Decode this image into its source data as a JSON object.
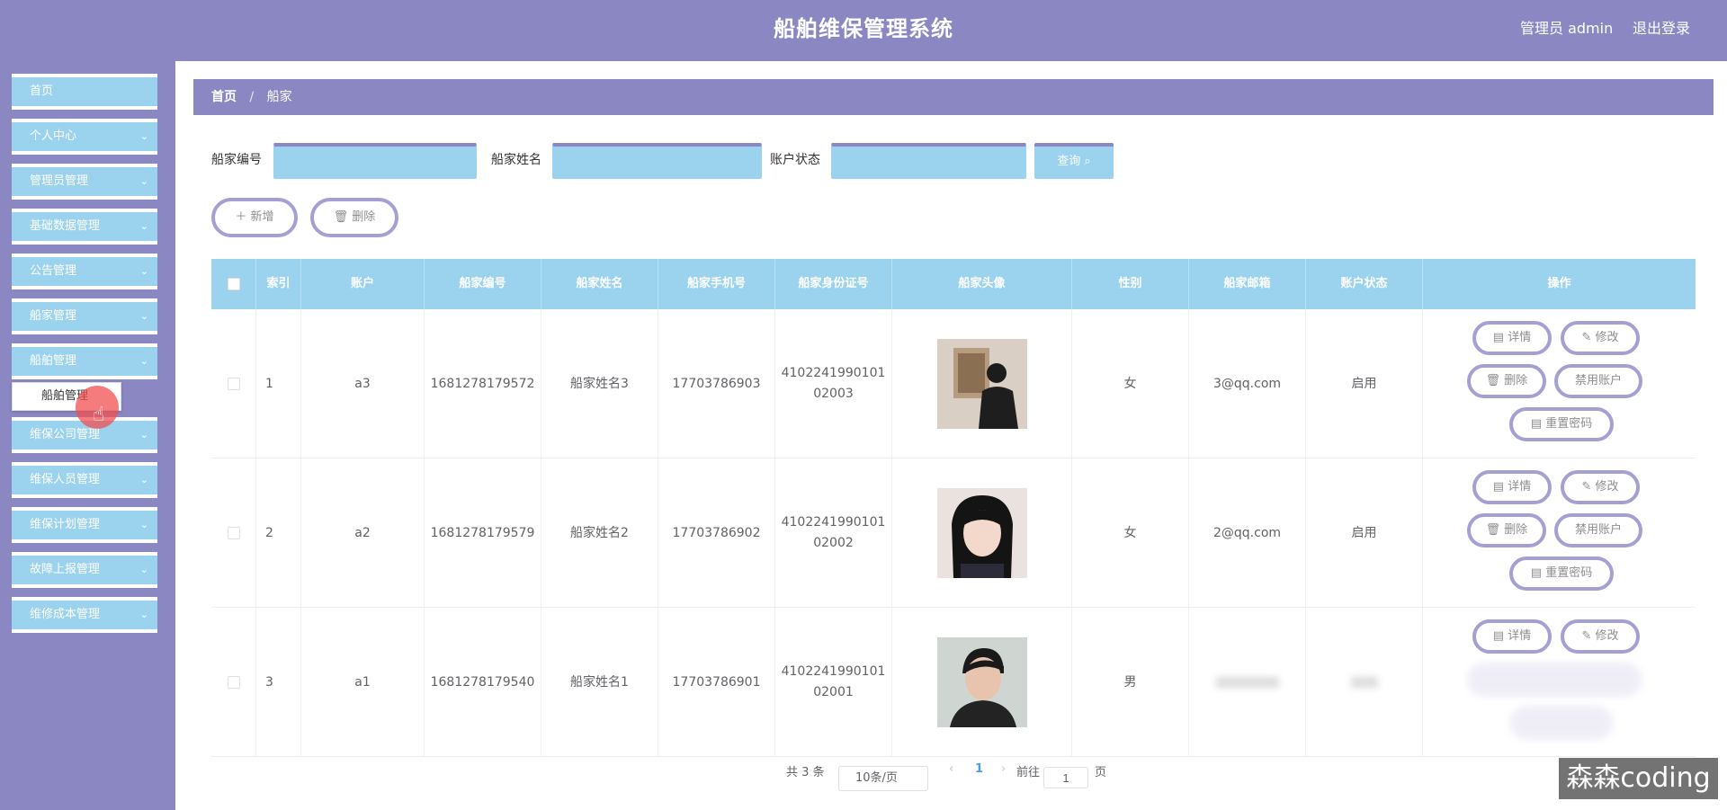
{
  "header": {
    "title": "船舶维保管理系统",
    "user": "管理员 admin",
    "logout": "退出登录"
  },
  "sidebar": {
    "items": [
      {
        "label": "首页"
      },
      {
        "label": "个人中心"
      },
      {
        "label": "管理员管理"
      },
      {
        "label": "基础数据管理"
      },
      {
        "label": "公告管理"
      },
      {
        "label": "船家管理"
      },
      {
        "label": "船舶管理"
      },
      {
        "label": "维保公司管理"
      },
      {
        "label": "维保人员管理"
      },
      {
        "label": "维保计划管理"
      },
      {
        "label": "故障上报管理"
      },
      {
        "label": "维修成本管理"
      }
    ],
    "submenu": {
      "label": "船舶管理"
    },
    "chevron": "⌄"
  },
  "breadcrumb": {
    "home": "首页",
    "sep": "/",
    "current": "船家"
  },
  "search": {
    "fields": [
      {
        "label": "船家编号"
      },
      {
        "label": "船家姓名"
      },
      {
        "label": "账户状态"
      }
    ],
    "query_label": "查询 ⌕"
  },
  "actions": {
    "add_label": "＋ 新增",
    "delete_label": "🗑 删除"
  },
  "table": {
    "columns": [
      "索引",
      "账户",
      "船家编号",
      "船家姓名",
      "船家手机号",
      "船家身份证号",
      "船家头像",
      "性别",
      "船家邮箱",
      "账户状态",
      "操作"
    ],
    "rows": [
      {
        "index": "1",
        "account": "a3",
        "no": "1681278179572",
        "name": "船家姓名3",
        "phone": "17703786903",
        "id_line1": "4102241990101",
        "id_line2": "02003",
        "gender": "女",
        "email": "3@qq.com",
        "status": "启用"
      },
      {
        "index": "2",
        "account": "a2",
        "no": "1681278179579",
        "name": "船家姓名2",
        "phone": "17703786902",
        "id_line1": "4102241990101",
        "id_line2": "02002",
        "gender": "女",
        "email": "2@qq.com",
        "status": "启用"
      },
      {
        "index": "3",
        "account": "a1",
        "no": "1681278179540",
        "name": "船家姓名1",
        "phone": "17703786901",
        "id_line1": "4102241990101",
        "id_line2": "02001",
        "gender": "男",
        "email": "",
        "status": ""
      }
    ],
    "ops": {
      "detail": "▤ 详情",
      "edit": "✎ 修改",
      "delete": "🗑 删除",
      "disable": "禁用账户",
      "reset": "▤ 重置密码"
    }
  },
  "pager": {
    "total": "共 3 条",
    "page_size": "10条/页",
    "prev": "‹",
    "current": "1",
    "next": "›",
    "goto": "前往",
    "goto_value": "1",
    "page_unit": "页"
  },
  "watermark": "森森coding",
  "colors": {
    "header": "#8a87c3",
    "accent": "#9bd3ef",
    "button_border": "#a5a0d3"
  }
}
